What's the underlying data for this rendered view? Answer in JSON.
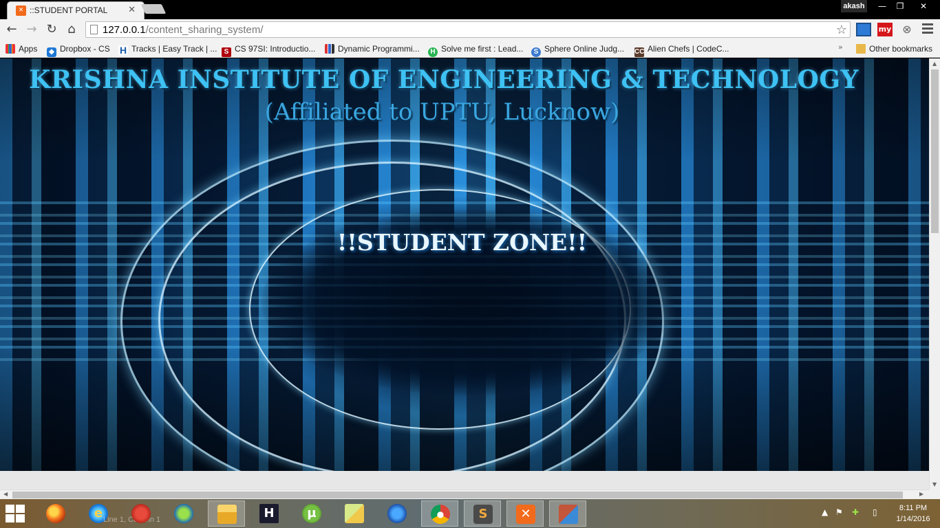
{
  "browser": {
    "tab": {
      "title": "::STUDENT PORTAL",
      "favicon": "xampp-icon"
    },
    "user": "akash",
    "window_controls": {
      "minimize": "—",
      "maximize": "❐",
      "close": "✕"
    },
    "url": {
      "host": "127.0.0.1",
      "path": "/content_sharing_system/"
    },
    "extensions": {
      "my_label": "my"
    }
  },
  "bookmarks": {
    "items": [
      {
        "label": "Apps",
        "icon": "apps-grid-icon"
      },
      {
        "label": "Dropbox - CS",
        "icon": "dropbox-icon"
      },
      {
        "label": "Tracks | Easy Track | ...",
        "icon": "hackerrank-icon"
      },
      {
        "label": "CS 97SI: Introductio...",
        "icon": "stanford-icon"
      },
      {
        "label": "Dynamic Programmi...",
        "icon": "bars-icon"
      },
      {
        "label": "Solve me first : Lead...",
        "icon": "hackerrank-green-icon"
      },
      {
        "label": "Sphere Online Judg...",
        "icon": "spoj-icon"
      },
      {
        "label": "Alien Chefs | CodeC...",
        "icon": "codechef-icon"
      }
    ],
    "more": "»",
    "other": "Other bookmarks"
  },
  "page": {
    "title": "KRISHNA INSTITUTE OF ENGINEERING & TECHNOLOGY",
    "subtitle": "(Affiliated to UPTU, Lucknow)",
    "zone": "!!STUDENT ZONE!!"
  },
  "taskbar": {
    "ghost_line": "Line 1, Column 1",
    "apps": [
      "firefox-icon",
      "internet-explorer-icon",
      "ccleaner-icon",
      "idm-icon",
      "file-explorer-icon",
      "hackerrank-icon",
      "utorrent-icon",
      "sticky-notes-icon",
      "firefox-dev-icon",
      "chrome-icon",
      "sublime-text-icon",
      "xampp-icon",
      "firewall-icon"
    ],
    "clock": {
      "time": "8:11 PM",
      "date": "1/14/2016"
    }
  },
  "colors": {
    "title": "#3ec1f3",
    "subtitle": "#3aa6e0",
    "zone": "#e8f6ff",
    "xampp": "#f26a1b"
  }
}
